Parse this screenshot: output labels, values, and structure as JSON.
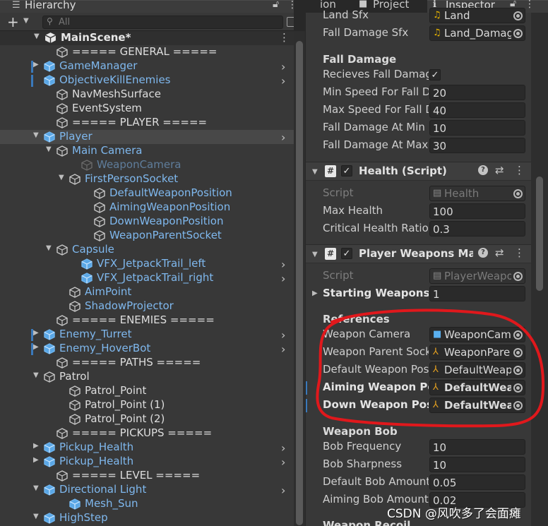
{
  "hierarchy": {
    "tab_title": "Hierarchy",
    "search_placeholder": "All",
    "scene_name": "MainScene*",
    "items": [
      {
        "label": "===== GENERAL =====",
        "style": "normal"
      },
      {
        "label": "GameManager",
        "style": "blue"
      },
      {
        "label": "ObjectiveKillEnemies",
        "style": "blue"
      },
      {
        "label": "NavMeshSurface",
        "style": "normal"
      },
      {
        "label": "EventSystem",
        "style": "normal"
      },
      {
        "label": "===== PLAYER =====",
        "style": "normal"
      },
      {
        "label": "Player",
        "style": "blue"
      },
      {
        "label": "Main Camera",
        "style": "blue"
      },
      {
        "label": "WeaponCamera",
        "style": "dim"
      },
      {
        "label": "FirstPersonSocket",
        "style": "blue"
      },
      {
        "label": "DefaultWeaponPosition",
        "style": "blue"
      },
      {
        "label": "AimingWeaponPosition",
        "style": "blue"
      },
      {
        "label": "DownWeaponPosition",
        "style": "blue"
      },
      {
        "label": "WeaponParentSocket",
        "style": "blue"
      },
      {
        "label": "Capsule",
        "style": "blue"
      },
      {
        "label": "VFX_JetpackTrail_left",
        "style": "blue"
      },
      {
        "label": "VFX_JetpackTrail_right",
        "style": "blue"
      },
      {
        "label": "AimPoint",
        "style": "blue"
      },
      {
        "label": "ShadowProjector",
        "style": "blue"
      },
      {
        "label": "===== ENEMIES =====",
        "style": "normal"
      },
      {
        "label": "Enemy_Turret",
        "style": "blue"
      },
      {
        "label": "Enemy_HoverBot",
        "style": "blue"
      },
      {
        "label": "===== PATHS =====",
        "style": "normal"
      },
      {
        "label": "Patrol",
        "style": "normal"
      },
      {
        "label": "Patrol_Point",
        "style": "normal"
      },
      {
        "label": "Patrol_Point (1)",
        "style": "normal"
      },
      {
        "label": "Patrol_Point (2)",
        "style": "normal"
      },
      {
        "label": "===== PICKUPS =====",
        "style": "normal"
      },
      {
        "label": "Pickup_Health",
        "style": "blue"
      },
      {
        "label": "Pickup_Health",
        "style": "blue"
      },
      {
        "label": "===== LEVEL =====",
        "style": "normal"
      },
      {
        "label": "Directional Light",
        "style": "blue"
      },
      {
        "label": "Mesh_Sun",
        "style": "blue"
      },
      {
        "label": "HighStep",
        "style": "blue"
      }
    ]
  },
  "inspector": {
    "tabs": [
      "ion",
      "Project",
      "Inspector"
    ],
    "top_rows": [
      {
        "label": "Land Sfx",
        "value": "Land",
        "icon": "audio-clip-icon"
      },
      {
        "label": "Fall Damage Sfx",
        "value": "Land_Damag",
        "icon": "audio-clip-icon"
      }
    ],
    "fall_damage": {
      "header": "Fall Damage",
      "recieves_label": "Recieves Fall Damage",
      "recieves_checked": "✓",
      "rows": [
        {
          "label": "Min Speed For Fall Damage",
          "value": "20"
        },
        {
          "label": "Max Speed For Fall Damage",
          "value": "40"
        },
        {
          "label": "Fall Damage At Min Speed",
          "value": "10"
        },
        {
          "label": "Fall Damage At Max Speed",
          "value": "30"
        }
      ]
    },
    "health_component": {
      "title": "Health (Script)",
      "script_label": "Script",
      "script_value": "Health",
      "rows": [
        {
          "label": "Max Health",
          "value": "100"
        },
        {
          "label": "Critical Health Ratio",
          "value": "0.3"
        }
      ]
    },
    "weapons_component": {
      "title": "Player Weapons Manager",
      "script_label": "Script",
      "script_value": "PlayerWeaponsManager",
      "starting_weapons_label": "Starting Weapons",
      "starting_weapons_count": "1",
      "references_header": "References",
      "references": [
        {
          "label": "Weapon Camera",
          "value": "WeaponCam",
          "icon": "camera-icon",
          "bold": false
        },
        {
          "label": "Weapon Parent Socket",
          "value": "WeaponPare",
          "icon": "transform-icon",
          "bold": false
        },
        {
          "label": "Default Weapon Position",
          "value": "DefaultWeap",
          "icon": "transform-icon",
          "bold": false
        },
        {
          "label": "Aiming Weapon Position",
          "value": "DefaultWeap",
          "icon": "transform-icon",
          "bold": true
        },
        {
          "label": "Down Weapon Position",
          "value": "DefaultWeap",
          "icon": "transform-icon",
          "bold": true
        }
      ],
      "bob_header": "Weapon Bob",
      "bob_rows": [
        {
          "label": "Bob Frequency",
          "value": "10"
        },
        {
          "label": "Bob Sharpness",
          "value": "10"
        },
        {
          "label": "Default Bob Amount",
          "value": "0.05"
        },
        {
          "label": "Aiming Bob Amount",
          "value": "0.02"
        }
      ],
      "recoil_header": "Weapon Recoil"
    }
  },
  "watermark": "CSDN @风吹多了会面瘫",
  "colors": {
    "annotation": "#e0181c",
    "prefab_blue": "#7fb8ee",
    "accent": "#3a79bb"
  }
}
